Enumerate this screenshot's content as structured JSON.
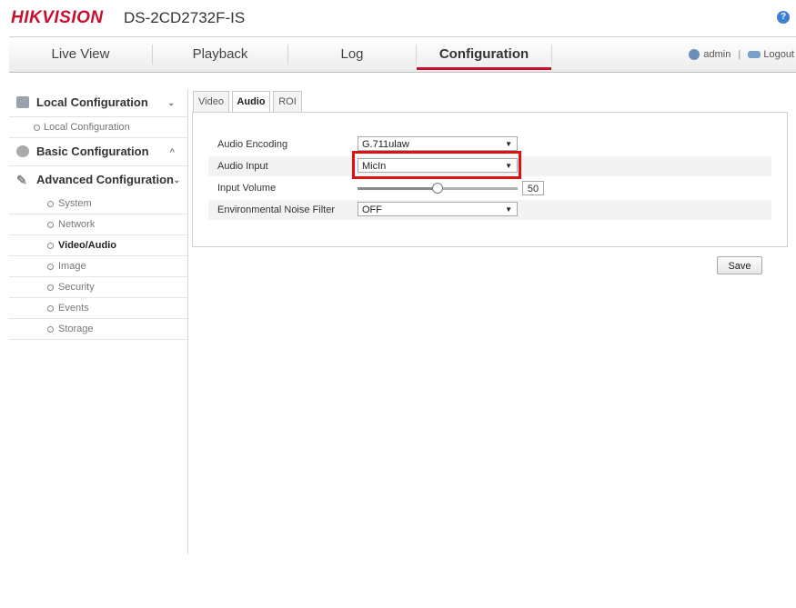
{
  "header": {
    "brand": "HIKVISION",
    "model": "DS-2CD2732F-IS",
    "help_icon": "question-icon",
    "help_glyph": "?"
  },
  "nav": {
    "tabs": [
      {
        "label": "Live View",
        "active": false
      },
      {
        "label": "Playback",
        "active": false
      },
      {
        "label": "Log",
        "active": false
      },
      {
        "label": "Configuration",
        "active": true
      }
    ],
    "user": "admin",
    "separator": "|",
    "logout": "Logout"
  },
  "sidebar": {
    "groups": [
      {
        "label": "Local Configuration",
        "icon": "monitor-icon",
        "chevron": "⌄",
        "items": [
          {
            "label": "Local Configuration",
            "active": false
          }
        ]
      },
      {
        "label": "Basic Configuration",
        "icon": "gear-icon",
        "chevron": "^",
        "items": []
      },
      {
        "label": "Advanced Configuration",
        "icon": "wrench-icon",
        "chevron": "⌄",
        "items": [
          {
            "label": "System",
            "active": false
          },
          {
            "label": "Network",
            "active": false
          },
          {
            "label": "Video/Audio",
            "active": true
          },
          {
            "label": "Image",
            "active": false
          },
          {
            "label": "Security",
            "active": false
          },
          {
            "label": "Events",
            "active": false
          },
          {
            "label": "Storage",
            "active": false
          }
        ]
      }
    ]
  },
  "tabs": [
    {
      "label": "Video",
      "active": false
    },
    {
      "label": "Audio",
      "active": true
    },
    {
      "label": "ROI",
      "active": false
    }
  ],
  "form": {
    "audio_encoding": {
      "label": "Audio Encoding",
      "value": "G.711ulaw"
    },
    "audio_input": {
      "label": "Audio Input",
      "value": "MicIn"
    },
    "input_volume": {
      "label": "Input Volume",
      "value": "50",
      "level": 0.5
    },
    "noise_filter": {
      "label": "Environmental Noise Filter",
      "value": "OFF"
    }
  },
  "save_label": "Save",
  "colors": {
    "brand_red": "#c8102e",
    "highlight_red": "#dd1111",
    "help_blue": "#3d7fd0"
  }
}
